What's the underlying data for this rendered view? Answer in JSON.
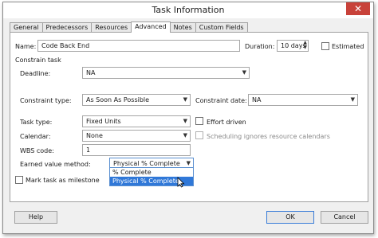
{
  "window": {
    "title": "Task Information",
    "close_glyph": "✕"
  },
  "tabs": [
    {
      "label": "General"
    },
    {
      "label": "Predecessors"
    },
    {
      "label": "Resources"
    },
    {
      "label": "Advanced",
      "active": true
    },
    {
      "label": "Notes"
    },
    {
      "label": "Custom Fields"
    }
  ],
  "name": {
    "label": "Name:",
    "value": "Code Back End"
  },
  "duration": {
    "label": "Duration:",
    "value": "10 days"
  },
  "estimated": {
    "label": "Estimated",
    "checked": false
  },
  "constrain_task": {
    "heading": "Constrain task"
  },
  "deadline": {
    "label": "Deadline:",
    "value": "NA"
  },
  "constraint_type": {
    "label": "Constraint type:",
    "value": "As Soon As Possible"
  },
  "constraint_date": {
    "label": "Constraint date:",
    "value": "NA"
  },
  "task_type": {
    "label": "Task type:",
    "value": "Fixed Units"
  },
  "effort_driven": {
    "label": "Effort driven",
    "checked": false
  },
  "calendar": {
    "label": "Calendar:",
    "value": "None"
  },
  "scheduling_ignores": {
    "label": "Scheduling ignores resource calendars",
    "checked": false,
    "disabled": true
  },
  "wbs_code": {
    "label": "WBS code:",
    "value": "1"
  },
  "earned_value": {
    "label": "Earned value method:",
    "value": "Physical % Complete",
    "options": [
      "% Complete",
      "Physical % Complete"
    ],
    "highlighted": "Physical % Complete"
  },
  "milestone": {
    "label": "Mark task as milestone",
    "checked": false
  },
  "buttons": {
    "help": "Help",
    "ok": "OK",
    "cancel": "Cancel"
  },
  "colors": {
    "highlight": "#3078d8",
    "close": "#c8423a",
    "focus_border": "#3b7dd8"
  }
}
